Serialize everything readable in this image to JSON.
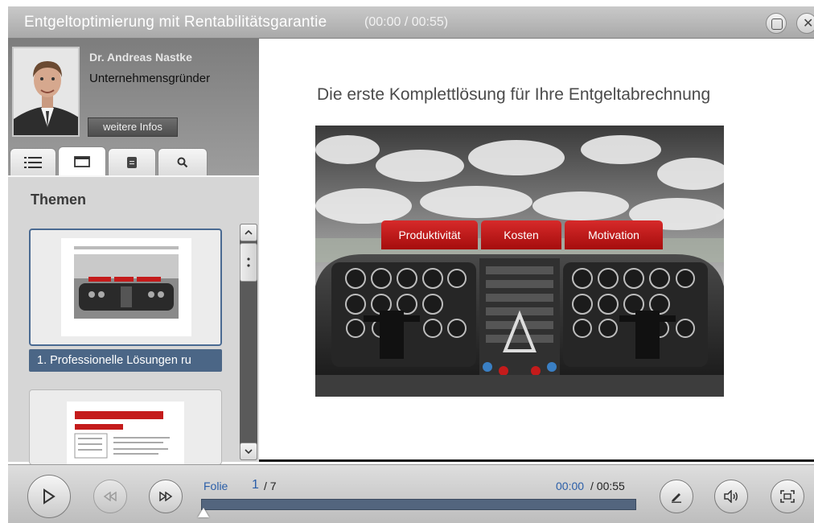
{
  "window": {
    "title": "Entgeltoptimierung mit Rentabilitätsgarantie",
    "time": "(00:00 / 00:55)"
  },
  "presenter": {
    "name": "Dr. Andreas Nastke",
    "role": "Unternehmensgründer",
    "more_info_label": "weitere Infos"
  },
  "sidebar": {
    "tabs": [
      {
        "id": "outline",
        "icon": "list-icon"
      },
      {
        "id": "slides",
        "icon": "slide-icon"
      },
      {
        "id": "notes",
        "icon": "notes-icon"
      },
      {
        "id": "search",
        "icon": "search-icon"
      }
    ],
    "active_tab": "slides",
    "section_title": "Themen",
    "thumbnails": [
      {
        "label": "1. Professionelle Lösungen ru",
        "selected": true
      },
      {
        "label": "",
        "selected": false
      }
    ]
  },
  "slide": {
    "title": "Die erste Komplettlösung für Ihre Entgeltabrechnung",
    "categories": [
      "Produktivität",
      "Kosten",
      "Motivation"
    ]
  },
  "player": {
    "slide_label": "Folie",
    "slide_current": "1",
    "slide_total": "/ 7",
    "time_current": "00:00",
    "time_total": "/ 00:55",
    "progress": 0
  },
  "colors": {
    "accent": "#4b6686",
    "category_red": "#c41b1b",
    "link_blue": "#2a5ea8"
  }
}
